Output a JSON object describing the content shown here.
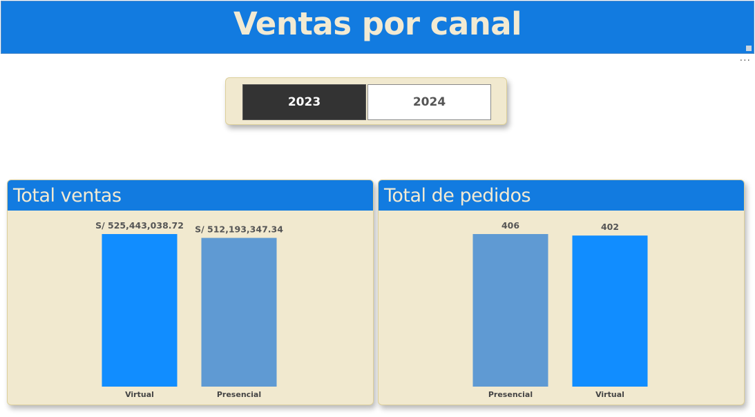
{
  "header": {
    "title": "Ventas por canal"
  },
  "more_icon": "more-options-icon",
  "slicer": {
    "options": [
      "2023",
      "2024"
    ],
    "selected": "2023"
  },
  "colors": {
    "header": "#127be0",
    "card_bg": "#f1e9cf",
    "bright_bar": "#118dff",
    "muted_bar": "#5f9ad3"
  },
  "chart_data": [
    {
      "type": "bar",
      "title": "Total ventas",
      "categories": [
        "Virtual",
        "Presencial"
      ],
      "values": [
        525443038.72,
        512193347.34
      ],
      "data_labels": [
        "S/ 525,443,038.72",
        "S/ 512,193,347.34"
      ],
      "bar_colors": [
        "#118dff",
        "#5f9ad3"
      ],
      "xlabel": "",
      "ylabel": "",
      "grid": false,
      "legend": "none"
    },
    {
      "type": "bar",
      "title": "Total de pedidos",
      "categories": [
        "Presencial",
        "Virtual"
      ],
      "values": [
        406,
        402
      ],
      "data_labels": [
        "406",
        "402"
      ],
      "bar_colors": [
        "#5f9ad3",
        "#118dff"
      ],
      "xlabel": "",
      "ylabel": "",
      "grid": false,
      "legend": "none"
    }
  ]
}
